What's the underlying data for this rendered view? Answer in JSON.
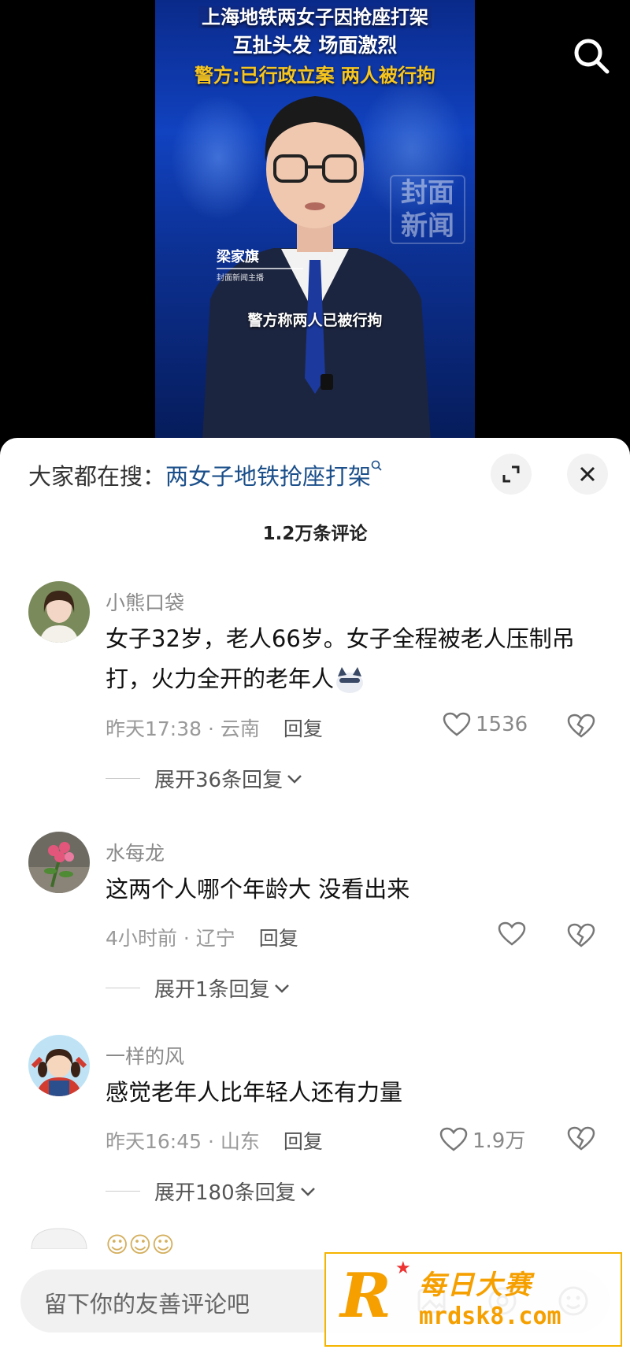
{
  "video": {
    "headline1": "上海地铁两女子因抢座打架",
    "headline2": "互扯头发 场面激烈",
    "headline3": "警方:已行政立案 两人被行拘",
    "watermark": "封面新闻",
    "anchor_name": "梁家旗",
    "anchor_sub": "封面新闻主播",
    "subtitle": "警方称两人已被行拘"
  },
  "panel": {
    "hot_search_prefix": "大家都在搜：",
    "hot_search_keyword": "两女子地铁抢座打架",
    "comment_count": "1.2万条评论"
  },
  "comments": [
    {
      "username": "小熊口袋",
      "text": "女子32岁，老人66岁。女子全程被老人压制吊打，火力全开的老年人",
      "time_location": "昨天17:38 · 云南",
      "reply_label": "回复",
      "likes": "1536",
      "expand_label": "展开36条回复"
    },
    {
      "username": "水每龙",
      "text": "这两个人哪个年龄大  没看出来",
      "time_location": "4小时前 · 辽宁",
      "reply_label": "回复",
      "likes": "",
      "expand_label": "展开1条回复"
    },
    {
      "username": "一样的风",
      "text": "感觉老年人比年轻人还有力量",
      "time_location": "昨天16:45 · 山东",
      "reply_label": "回复",
      "likes": "1.9万",
      "expand_label": "展开180条回复"
    }
  ],
  "input": {
    "placeholder": "留下你的友善评论吧"
  },
  "ad": {
    "brand_cn": "每日大赛",
    "brand_url": "mrdsk8.com"
  },
  "colors": {
    "keyword": "#1b4f8a",
    "accent_gold": "#f5a000",
    "headline_yellow": "#f7c51e"
  }
}
